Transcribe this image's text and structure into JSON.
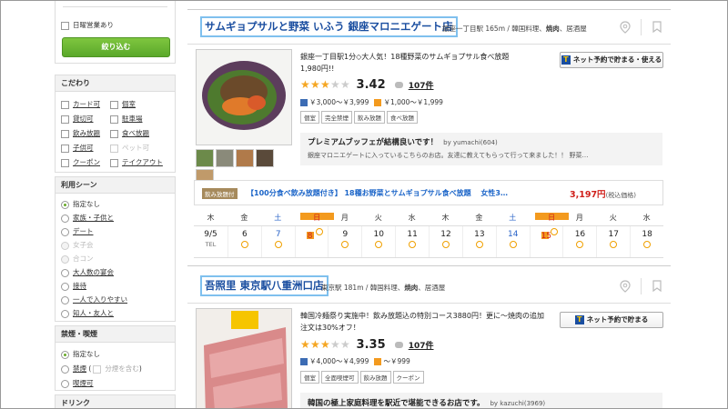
{
  "sidebar": {
    "sunday_label": "日曜営業あり",
    "filter_button": "絞り込む",
    "kodawari": {
      "title": "こだわり",
      "items": [
        {
          "label": "カード可",
          "underline": true
        },
        {
          "label": "個室",
          "underline": true
        },
        {
          "label": "貸切可",
          "underline": true
        },
        {
          "label": "駐車場",
          "underline": true
        },
        {
          "label": "飲み放題",
          "underline": true
        },
        {
          "label": "食べ放題",
          "underline": true
        },
        {
          "label": "子供可",
          "underline": true
        },
        {
          "label": "ペット可",
          "underline": false
        },
        {
          "label": "クーポン",
          "underline": true
        },
        {
          "label": "テイクアウト",
          "underline": true
        }
      ]
    },
    "scene": {
      "title": "利用シーン",
      "items": [
        "指定なし",
        "家族・子供と",
        "デート",
        "女子会",
        "合コン",
        "大人数の宴会",
        "接待",
        "一人で入りやすい",
        "知人・友人と"
      ]
    },
    "smoking": {
      "title": "禁煙・喫煙",
      "items": [
        "指定なし",
        "禁煙",
        "分煙を含む",
        "喫煙可"
      ]
    },
    "drink_title": "ドリンク"
  },
  "shops": [
    {
      "name": "サムギョプサルと野菜 いふう 銀座マロニエゲート店",
      "access": "銀座一丁目駅 165m / 韓国料理、",
      "genre_bold": "焼肉",
      "genre_rest": "、居酒屋",
      "catch": "銀座一丁目駅1分◇大人気！18種野菜のサムギョプサル食べ放題 1,980円!!",
      "net_button": "ネット予約で貯まる・使える",
      "score": "3.42",
      "reviews": "107件",
      "budget_dinner": "￥3,000～￥3,999",
      "budget_lunch": "￥1,000～￥1,999",
      "tags": [
        "個室",
        "完全禁煙",
        "飲み放題",
        "食べ放題"
      ],
      "review_title": "プレミアムブッフェが結構良いです！",
      "review_by": "by yumachi(604)",
      "review_body": "銀座マロニエゲートに入っているこちらのお店。友達に教えてもらって行って来ました！！ 野菜…",
      "course_label": "飲み放題付",
      "course_title": "【100分食べ飲み放題付き】 18種お野菜とサムギョプサル食べ放題　 女性3…",
      "course_price": "3,197円",
      "course_tax": "(税込価格)",
      "calendar": {
        "weekdays": [
          "木",
          "金",
          "土",
          "日",
          "月",
          "火",
          "水",
          "木",
          "金",
          "土",
          "日",
          "月",
          "火",
          "水"
        ],
        "dates": [
          "9/5",
          "6",
          "7",
          "8",
          "9",
          "10",
          "11",
          "12",
          "13",
          "14",
          "15",
          "16",
          "17",
          "18"
        ],
        "tel_label": "TEL"
      }
    },
    {
      "name": "吾照里 東京駅八重洲口店",
      "access": "東京駅 181m / 韓国料理、",
      "genre_bold": "焼肉",
      "genre_rest": "、居酒屋",
      "catch": "韓国冷麺祭り実施中！飲み放題込の特別コース3880円！更に～焼肉の追加注文は30%オフ！",
      "net_button": "ネット予約で貯まる",
      "score": "3.35",
      "reviews": "107件",
      "budget_dinner": "￥4,000～￥4,999",
      "budget_lunch": "～￥999",
      "tags": [
        "個室",
        "全面喫煙可",
        "飲み放題",
        "クーポン"
      ],
      "review_title": "韓国の極上家庭料理を駅近で堪能できるお店です。",
      "review_by": "by kazuchi(3969)"
    }
  ],
  "colors": {
    "title_blue": "#1a4ea0",
    "highlight_border": "#7fc0ee",
    "green": "#6aaa2a",
    "price_red": "#d0201b",
    "star": "#f5a623"
  }
}
